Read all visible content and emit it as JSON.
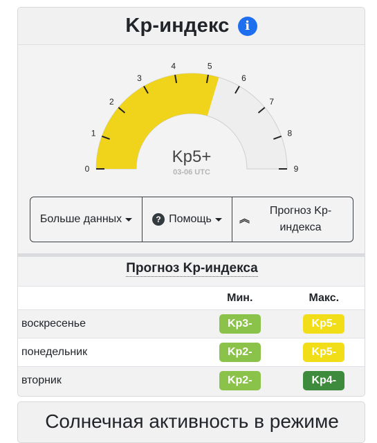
{
  "header": {
    "title": "Kp-индекс",
    "info_icon": "info-circle-icon"
  },
  "gauge": {
    "value": 5.33,
    "max": 9,
    "display_value": "Kp5+",
    "time_label": "03-06 UTC",
    "tick_labels": [
      "0",
      "1",
      "2",
      "3",
      "4",
      "5",
      "6",
      "7",
      "8",
      "9"
    ],
    "fill_color": "#f0d31b",
    "track_color": "#eeeeee"
  },
  "buttons": {
    "more_label": "Больше данных",
    "help_label": "Помощь",
    "forecast_label": "Прогноз Kp-индекса"
  },
  "forecast": {
    "title": "Прогноз Kp-индекса",
    "columns": [
      "",
      "Мин.",
      "Макс."
    ],
    "rows": [
      {
        "day": "воскресенье",
        "min": "Kp3-",
        "max": "Kp5-",
        "min_color": "#8bc34a",
        "max_color": "#f1dd18"
      },
      {
        "day": "понедельник",
        "min": "Kp2-",
        "max": "Kp5-",
        "min_color": "#8bc34a",
        "max_color": "#f1dd18"
      },
      {
        "day": "вторник",
        "min": "Kp2-",
        "max": "Kp4-",
        "min_color": "#8bc34a",
        "max_color": "#3e8b3e"
      }
    ]
  },
  "solar": {
    "title": "Солнечная активность в режиме"
  }
}
